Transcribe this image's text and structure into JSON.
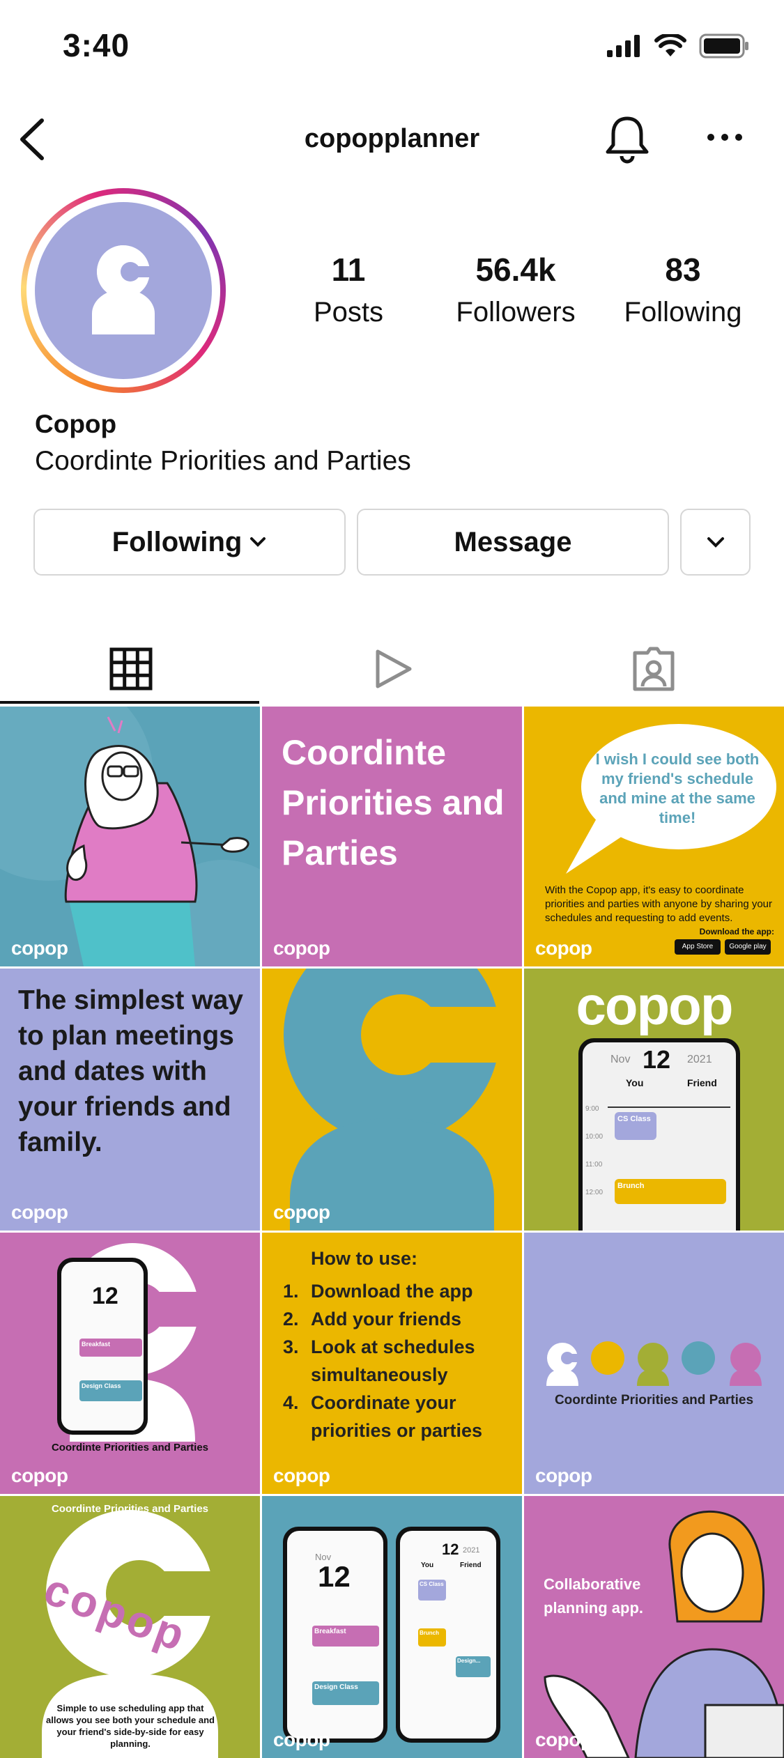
{
  "status_bar": {
    "time": "3:40"
  },
  "header": {
    "username": "copopplanner"
  },
  "stats": [
    {
      "number": "11",
      "label": "Posts"
    },
    {
      "number": "56.4k",
      "label": "Followers"
    },
    {
      "number": "83",
      "label": "Following"
    }
  ],
  "bio": {
    "name": "Copop",
    "text": "Coordinte Priorities and Parties"
  },
  "buttons": {
    "following": "Following",
    "message": "Message"
  },
  "colors": {
    "purple": "#a3a7dc",
    "pink": "#c66eb3",
    "yellow": "#ebb700",
    "teal": "#5ba3b8",
    "olive": "#a3ae35"
  },
  "posts": {
    "watermark": "copop",
    "p2": {
      "title": "Coordinte Priorities and Parties"
    },
    "p3": {
      "bubble": "I wish I could see both my friend's schedule and mine at the same time!",
      "body": "With the Copop app, it's easy to coordinate priorities and parties with anyone by sharing your schedules and requesting to add events.",
      "download": "Download the app:",
      "appstore": "App Store",
      "googleplay": "Google play"
    },
    "p4": {
      "text": "The simplest way to plan meetings and dates with your friends and family."
    },
    "p6": {
      "logo": "copop",
      "day": "12",
      "month": "Nov",
      "year": "2021",
      "col_you": "You",
      "col_friend": "Friend",
      "times": [
        "9:00",
        "10:00",
        "11:00",
        "12:00"
      ],
      "event1": "CS Class",
      "event2": "Brunch"
    },
    "p7": {
      "caption": "Coordinte Priorities and Parties",
      "day": "12",
      "event1": "Breakfast",
      "event2": "Design Class"
    },
    "p8": {
      "title": "How to use:",
      "steps": [
        "Download the app",
        "Add your friends",
        "Look at schedules simultaneously",
        "Coordinate your priorities or parties"
      ]
    },
    "p9": {
      "caption": "Coordinte Priorities and Parties"
    },
    "p10": {
      "caption": "Coordinte Priorities and Parties",
      "logo": "copop",
      "body": "Simple to use scheduling app that allows you see both your schedule and your friend's side-by-side for easy planning."
    },
    "p11": {
      "day": "12",
      "month": "Nov",
      "year": "2021",
      "col_you": "You",
      "col_friend": "Friend",
      "event1": "Breakfast",
      "event2": "Design Class",
      "event3": "CS Class",
      "event4": "Brunch",
      "event5": "Design..."
    },
    "p12": {
      "text": "Collaborative planning app."
    }
  }
}
